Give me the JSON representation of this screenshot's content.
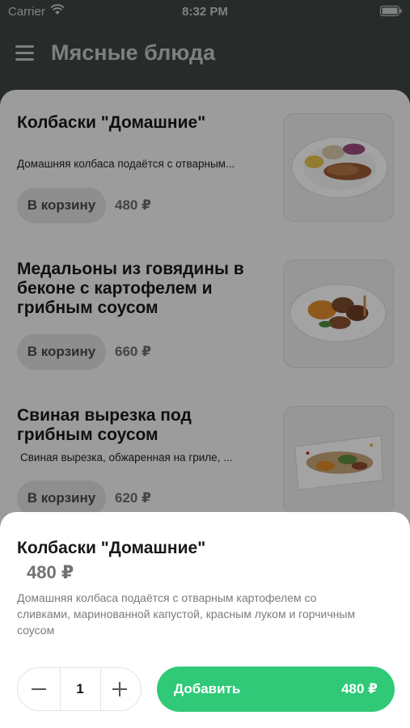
{
  "status_bar": {
    "carrier": "Carrier",
    "time": "8:32 PM",
    "wifi_icon": "wifi-icon",
    "battery_icon": "battery-icon"
  },
  "nav": {
    "menu_icon": "hamburger-menu-icon",
    "title": "Мясные блюда"
  },
  "items": [
    {
      "title": "Колбаски \"Домашние\"",
      "description": "Домашняя колбаса подаётся с отварным...",
      "cart_label": "В корзину",
      "price": "480 ₽"
    },
    {
      "title": "Медальоны из говядины в беконе с картофелем и грибным соусом",
      "description": "",
      "cart_label": "В корзину",
      "price": "660 ₽"
    },
    {
      "title": "Свиная вырезка под грибным соусом",
      "description": "Свиная вырезка, обжаренная на гриле, ...",
      "cart_label": "В корзину",
      "price": "620 ₽"
    }
  ],
  "sheet": {
    "title": "Колбаски \"Домашние\"",
    "price": "480 ₽",
    "description": "Домашняя колбаса подаётся с отварным картофелем со сливками, маринованной капустой, красным луком и горчичным соусом",
    "quantity": "1",
    "add_label": "Добавить",
    "add_price": "480 ₽"
  },
  "colors": {
    "header_bg": "#3e4543",
    "accent_green": "#2fc977",
    "cart_button_bg": "#dedede"
  }
}
